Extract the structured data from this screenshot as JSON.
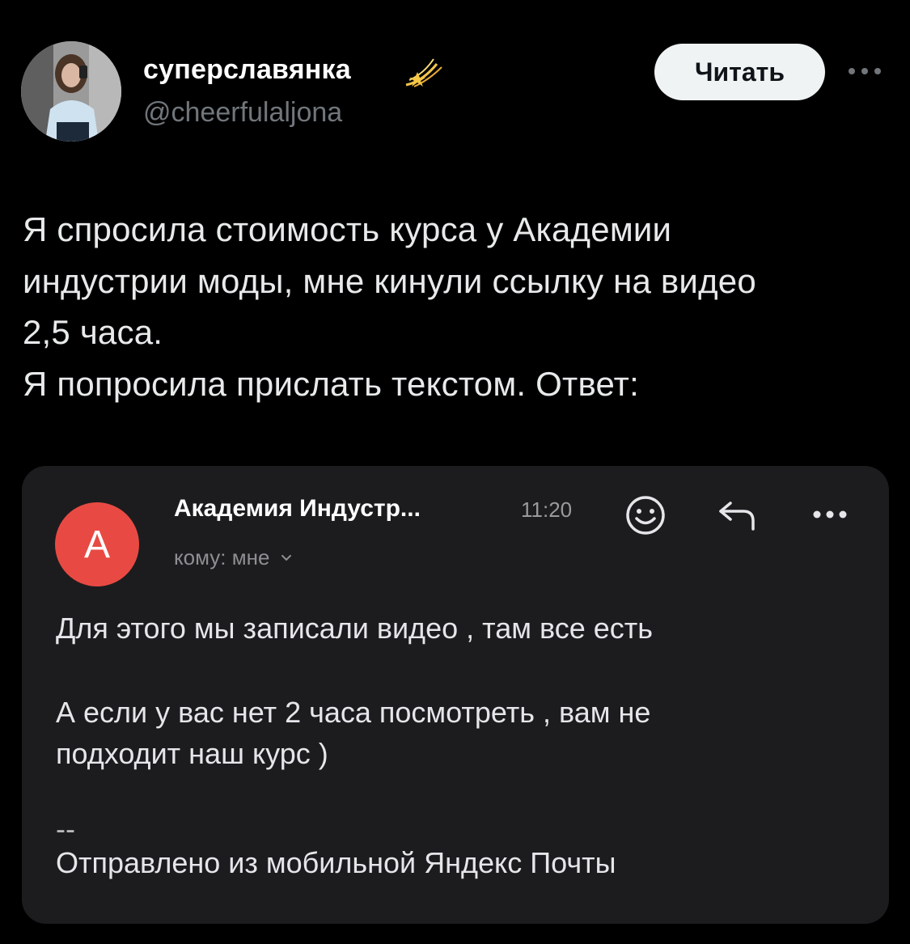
{
  "author": {
    "name": "суперславянка",
    "handle": "@cheerfulaljona",
    "badge_icon": "comet-icon"
  },
  "header": {
    "read_button_label": "Читать",
    "more_icon": "more-horizontal-icon"
  },
  "tweet": {
    "lines": [
      "Я спросила стоимость курса у Академии",
      "индустрии моды, мне кинули ссылку на видео",
      "2,5 часа.",
      "Я попросила прислать текстом. Ответ:"
    ]
  },
  "email": {
    "avatar_letter": "А",
    "avatar_color": "#e84a43",
    "sender": "Академия Индустр...",
    "time": "11:20",
    "recipient": "кому: мне",
    "icons": [
      "emoji-icon",
      "reply-icon",
      "more-horizontal-icon",
      "chevron-down-icon"
    ],
    "body_line_1": "Для этого мы записали видео , там все есть",
    "body_line_2": "А если у вас нет 2 часа посмотреть , вам не",
    "body_line_3": "подходит наш курс )",
    "signature_separator": "--",
    "signature": "Отправлено из мобильной Яндекс Почты"
  },
  "colors": {
    "background": "#000000",
    "card_background": "#1c1c1e",
    "secondary_text": "#71767b",
    "button_background": "#eff3f4"
  }
}
